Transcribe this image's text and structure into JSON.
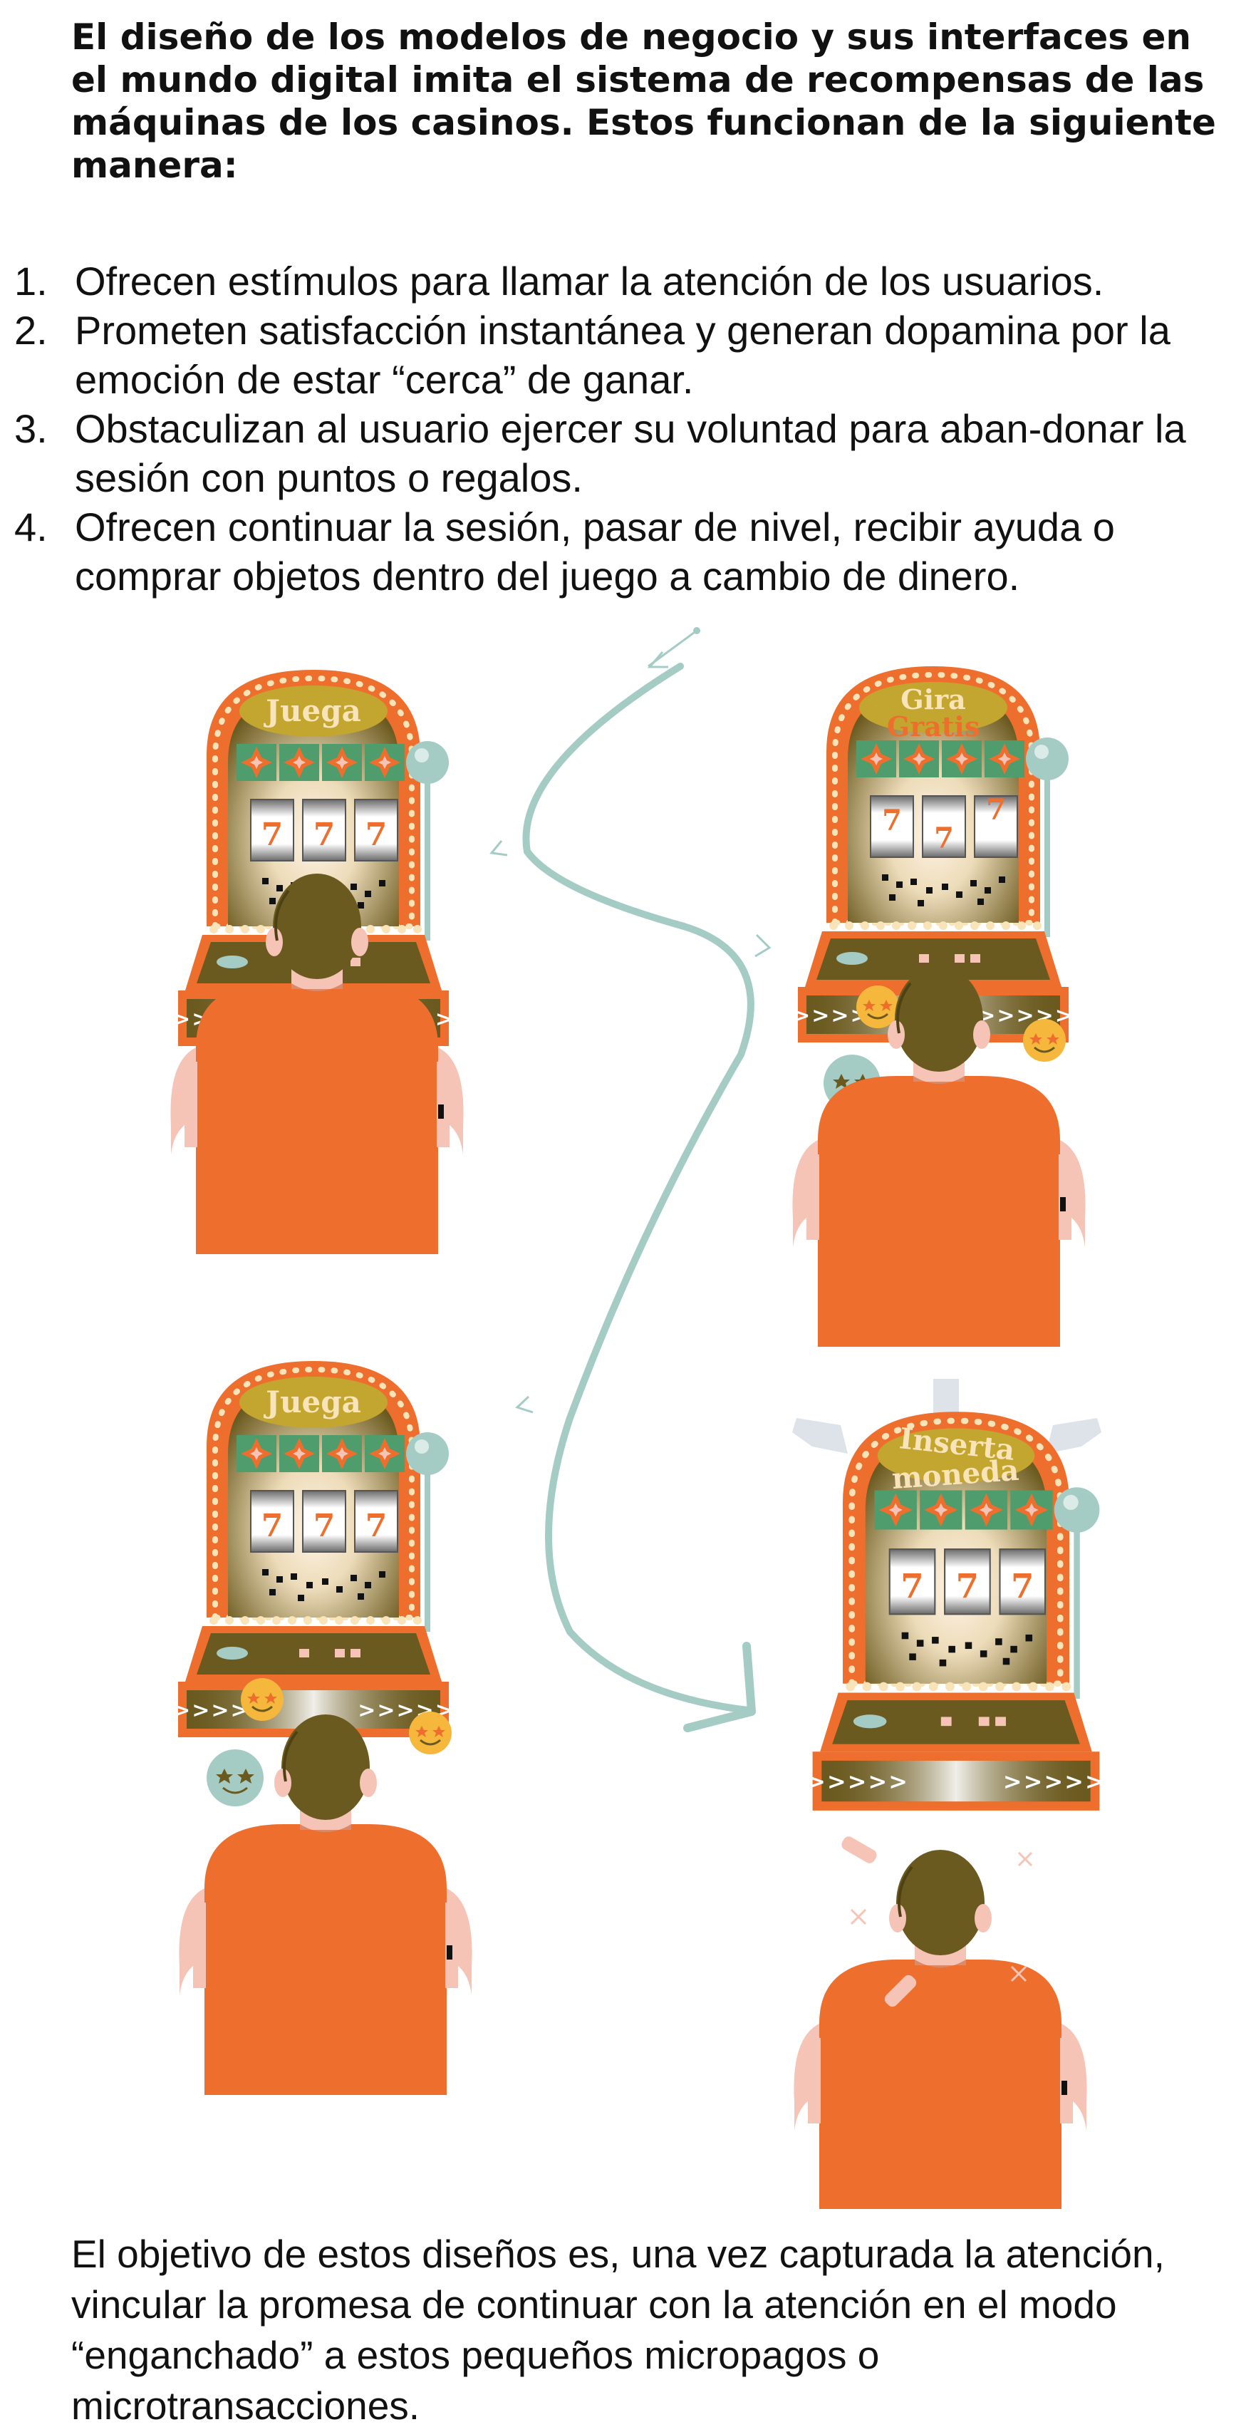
{
  "heading": "El diseño de los modelos de negocio y sus interfaces en el mundo digital imita el sistema de recompensas de las máquinas de los casinos. Estos funcionan de la siguiente manera:",
  "steps": [
    {
      "num": "1.",
      "text": "Ofrecen estímulos para llamar la atención de los usuarios."
    },
    {
      "num": "2.",
      "text": "Prometen satisfacción instantánea y generan dopamina por la emoción de estar “cerca” de ganar."
    },
    {
      "num": "3.",
      "text": "Obstaculizan al usuario ejercer su voluntad para aban-donar la sesión con puntos o regalos."
    },
    {
      "num": "4.",
      "text": "Ofrecen continuar la sesión, pasar de nivel, recibir ayuda o comprar objetos dentro del juego a cambio de dinero."
    }
  ],
  "machines": {
    "m1": {
      "sign1": "Juega",
      "sign2": ""
    },
    "m2": {
      "sign1": "Gira",
      "sign2": "Gratis"
    },
    "m3": {
      "sign1": "Juega",
      "sign2": ""
    },
    "m4": {
      "sign1": "Inserta",
      "sign2": "moneda"
    },
    "reel_symbol": "7",
    "tray_text": ">>>>>          >>>>>"
  },
  "closing": "El objetivo de estos diseños es, una vez capturada la atención, vincular la promesa de continuar con la atención en el modo “enganchado” a estos pequeños micropagos o microtransacciones.",
  "colors": {
    "orange": "#ee6f2d",
    "olive": "#6b5a1f",
    "mint": "#a5ccc4",
    "gold": "#f5b83c",
    "skin": "#f6c4b6"
  }
}
